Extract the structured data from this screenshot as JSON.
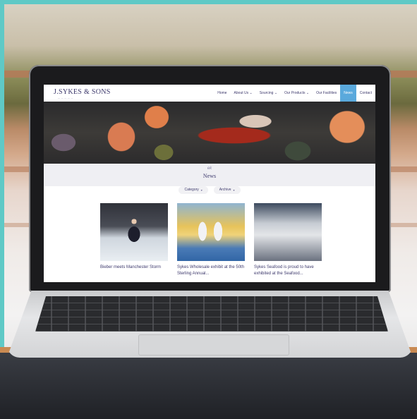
{
  "site": {
    "logo": "J.SYKES & SONS",
    "nav": [
      {
        "label": "Home",
        "active": false
      },
      {
        "label": "About Us ⌄",
        "active": false
      },
      {
        "label": "Sourcing ⌄",
        "active": false
      },
      {
        "label": "Our Products ⌄",
        "active": false
      },
      {
        "label": "Our Facilities",
        "active": false
      },
      {
        "label": "News",
        "active": true
      },
      {
        "label": "Contact",
        "active": false
      }
    ],
    "section_mark": "ek",
    "section_title": "News",
    "filters": [
      {
        "label": "Category"
      },
      {
        "label": "Archive"
      }
    ],
    "posts": [
      {
        "title": "Bieber meets Manchester Storm"
      },
      {
        "title": "Sykes Wholesale exhibit at the 50th Sterling Annual..."
      },
      {
        "title": "Sykes Seafood is proud to have exhibited at the Seafood..."
      }
    ]
  },
  "colors": {
    "frame": "#5fc9c6",
    "brand_text": "#3e3a6d",
    "nav_active": "#5aa9dc"
  }
}
